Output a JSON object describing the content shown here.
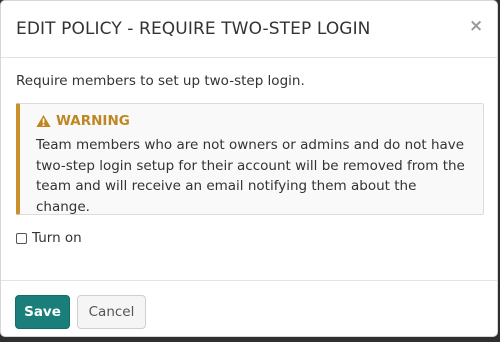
{
  "modal": {
    "title": "EDIT POLICY - REQUIRE TWO-STEP LOGIN",
    "close_icon": "close-icon"
  },
  "body": {
    "intro": "Require members to set up two-step login.",
    "warning": {
      "icon": "warning-triangle-icon",
      "heading": "WARNING",
      "text": "Team members who are not owners or admins and do not have two-step login setup for their account will be removed from the team and will receive an email notifying them about the change.",
      "accent_color": "#bf8724"
    },
    "turn_on": {
      "label": "Turn on",
      "checked": false
    }
  },
  "footer": {
    "save_label": "Save",
    "cancel_label": "Cancel",
    "primary_color": "#1a7f7a"
  }
}
